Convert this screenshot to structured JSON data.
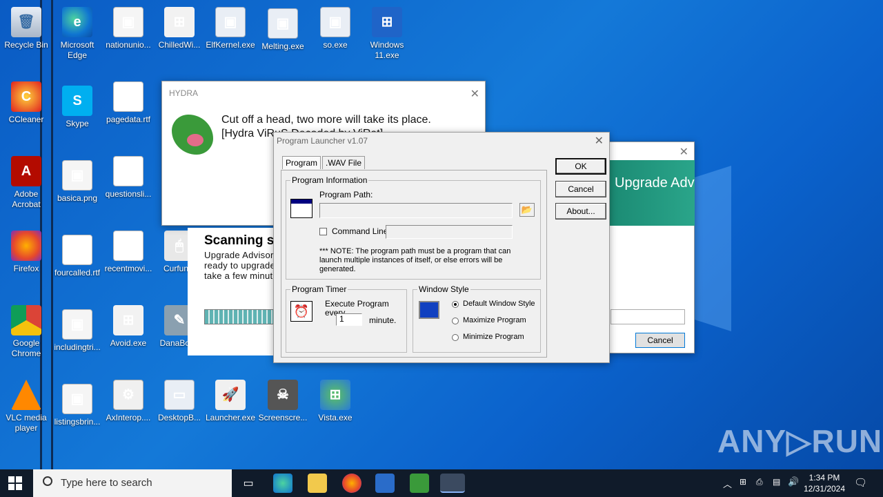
{
  "desktop_icons": [
    {
      "label": "Recycle Bin",
      "glyph": "🗑"
    },
    {
      "label": "Microsoft Edge",
      "glyph": "e"
    },
    {
      "label": "nationunio...",
      "glyph": "▣"
    },
    {
      "label": "ChilledWi...",
      "glyph": "⊞"
    },
    {
      "label": "ElfKernel.exe",
      "glyph": "▣"
    },
    {
      "label": "Melting.exe",
      "glyph": "▣"
    },
    {
      "label": "so.exe",
      "glyph": "▣"
    },
    {
      "label": "Windows 11.exe",
      "glyph": "⊞"
    },
    {
      "label": "CCleaner",
      "glyph": "C"
    },
    {
      "label": "Skype",
      "glyph": "S"
    },
    {
      "label": "pagedata.rtf",
      "glyph": "W"
    },
    {
      "label": "Adobe Acrobat",
      "glyph": "A"
    },
    {
      "label": "basica.png",
      "glyph": "▣"
    },
    {
      "label": "questionsli...",
      "glyph": "W"
    },
    {
      "label": "Firefox",
      "glyph": ""
    },
    {
      "label": "fourcalled.rtf",
      "glyph": "W"
    },
    {
      "label": "recentmovi...",
      "glyph": "W"
    },
    {
      "label": "Curfun...",
      "glyph": "🖱"
    },
    {
      "label": "Google Chrome",
      "glyph": ""
    },
    {
      "label": "includingtri...",
      "glyph": "▣"
    },
    {
      "label": "Avoid.exe",
      "glyph": "⊞"
    },
    {
      "label": "DanaBot...",
      "glyph": "✎"
    },
    {
      "label": "VLC media player",
      "glyph": ""
    },
    {
      "label": "listingsbrin...",
      "glyph": "▣"
    },
    {
      "label": "AxInterop....",
      "glyph": "⚙"
    },
    {
      "label": "DesktopB...",
      "glyph": "▭"
    },
    {
      "label": "Launcher.exe",
      "glyph": "🚀"
    },
    {
      "label": "Screenscre...",
      "glyph": "☠"
    },
    {
      "label": "Vista.exe",
      "glyph": "⊞"
    }
  ],
  "hydra": {
    "title": "HYDRA",
    "line1": "Cut off a head, two more will take its place.",
    "line2": "[Hydra ViRuS Decoded by ViRat]"
  },
  "scan": {
    "title": "Scanning system...",
    "desc": "Upgrade Advisor is getting ready to upgrade... this may take a few minutes."
  },
  "advisor": {
    "banner": "Upgrade Advisor",
    "cancel": "Cancel"
  },
  "launcher": {
    "title": "Program Launcher v1.07",
    "tab_program": "Program",
    "tab_wav": ".WAV File",
    "ok": "OK",
    "cancel": "Cancel",
    "about": "About...",
    "group_info": "Program Information",
    "program_path_label": "Program Path:",
    "command_line_label": "Command Line",
    "note": "*** NOTE: The program path must be a program that can launch multiple instances of itself, or else errors will be generated.",
    "group_timer": "Program Timer",
    "execute_label": "Execute Program every",
    "timer_value": "1",
    "minute_label": "minute.",
    "group_style": "Window Style",
    "style_default": "Default Window Style",
    "style_max": "Maximize Program",
    "style_min": "Minimize Program"
  },
  "taskbar": {
    "search_placeholder": "Type here to search",
    "time": "1:34 PM",
    "date": "12/31/2024"
  },
  "watermark": "ANY▷RUN",
  "colors": {
    "desktop_bg": "#1479d8",
    "taskbar_bg": "#101b2a",
    "advisor_banner": "#1b8a73"
  }
}
